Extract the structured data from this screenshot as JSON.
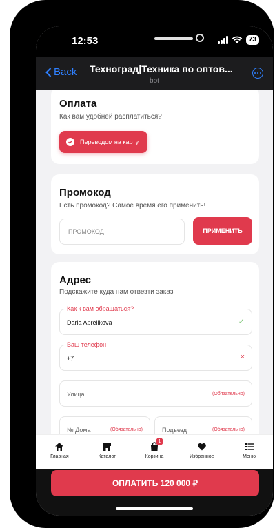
{
  "status_bar": {
    "time": "12:53",
    "battery": "73"
  },
  "nav": {
    "back_label": "Back",
    "title": "Техноград|Техника по оптов...",
    "subtitle": "bot"
  },
  "payment": {
    "title": "Оплата",
    "subtitle": "Как вам удобней расплатиться?",
    "option_label": "Переводом на карту"
  },
  "promo": {
    "title": "Промокод",
    "subtitle": "Есть промокод? Самое время его применить!",
    "placeholder": "ПРОМОКОД",
    "apply_label": "ПРИМЕНИТЬ"
  },
  "address": {
    "title": "Адрес",
    "subtitle": "Подскажите куда нам отвезти заказ",
    "name_label": "Как к вам обращаться?",
    "name_value": "Daria Aprelikova",
    "phone_label": "Ваш телефон",
    "phone_value": "+7",
    "street_placeholder": "Улица",
    "house_placeholder": "№ Дома",
    "entrance_placeholder": "Подъезд",
    "required_label": "(Обязательно)"
  },
  "tabs": [
    {
      "label": "Главная",
      "icon": "home-icon"
    },
    {
      "label": "Каталог",
      "icon": "store-icon"
    },
    {
      "label": "Корзина",
      "icon": "bag-icon",
      "badge": "1"
    },
    {
      "label": "Избранное",
      "icon": "heart-icon"
    },
    {
      "label": "Меню",
      "icon": "menu-icon"
    }
  ],
  "pay_button_label": "ОПЛАТИТЬ 120 000 ₽",
  "colors": {
    "accent": "#e03a4d",
    "nav_bg": "#1c1c1e",
    "link": "#2f80ff",
    "success": "#7cc576"
  }
}
